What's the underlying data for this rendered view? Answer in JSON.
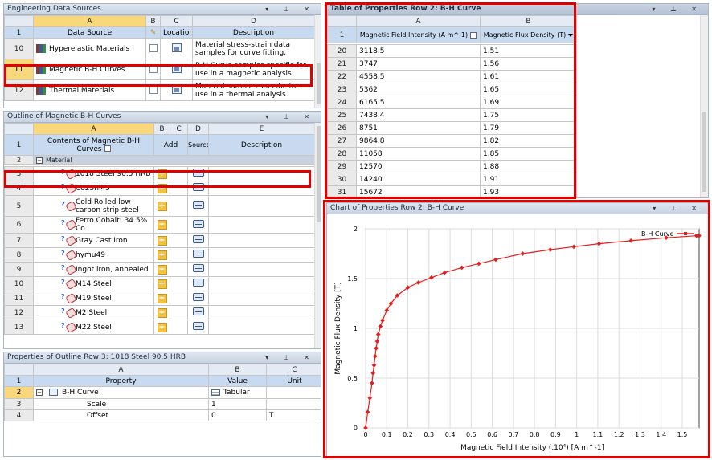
{
  "eds": {
    "title": "Engineering Data Sources",
    "col_letters": [
      "A",
      "B",
      "C",
      "D"
    ],
    "headers": [
      "Data Source",
      "Location",
      "Description"
    ],
    "rows": [
      {
        "n": "10",
        "name": "Hyperelastic Materials",
        "desc": "Material stress-strain data samples for curve fitting."
      },
      {
        "n": "11",
        "name": "Magnetic B-H Curves",
        "desc": "B-H Curve samples specific for use in a magnetic analysis."
      },
      {
        "n": "12",
        "name": "Thermal Materials",
        "desc": "Material samples specific for use in a thermal analysis."
      }
    ]
  },
  "outline": {
    "title": "Outline of Magnetic B-H Curves",
    "col_letters": [
      "A",
      "B",
      "C",
      "D",
      "E"
    ],
    "headers": [
      "Contents of Magnetic B-H Curves",
      "Add",
      "Source",
      "Description"
    ],
    "group": "Material",
    "rows": [
      {
        "n": "3",
        "name": "1018 Steel 90.5 HRB"
      },
      {
        "n": "4",
        "name": "Co25ni45"
      },
      {
        "n": "5",
        "name": "Cold Rolled low carbon strip steel"
      },
      {
        "n": "6",
        "name": "Ferro Cobalt: 34.5% Co"
      },
      {
        "n": "7",
        "name": "Gray Cast Iron"
      },
      {
        "n": "8",
        "name": "hymu49"
      },
      {
        "n": "9",
        "name": "Ingot iron, annealed"
      },
      {
        "n": "10",
        "name": "M14 Steel"
      },
      {
        "n": "11",
        "name": "M19 Steel"
      },
      {
        "n": "12",
        "name": "M2 Steel"
      },
      {
        "n": "13",
        "name": "M22 Steel"
      }
    ]
  },
  "props": {
    "title": "Properties of Outline Row 3: 1018 Steel 90.5 HRB",
    "col_letters": [
      "A",
      "B",
      "C"
    ],
    "headers": [
      "Property",
      "Value",
      "Unit"
    ],
    "rows": [
      {
        "n": "2",
        "prop": "B-H Curve",
        "value": "Tabular",
        "unit": ""
      },
      {
        "n": "3",
        "prop": "Scale",
        "value": "1",
        "unit": ""
      },
      {
        "n": "4",
        "prop": "Offset",
        "value": "0",
        "unit": "T"
      }
    ]
  },
  "table": {
    "title": "Table of Properties Row 2: B-H Curve",
    "col_letters": [
      "A",
      "B"
    ],
    "headers": [
      "Magnetic Field Intensity (A m^-1)",
      "Magnetic Flux Density (T)"
    ],
    "rows": [
      {
        "n": "20",
        "h": "3118.5",
        "b": "1.51"
      },
      {
        "n": "21",
        "h": "3747",
        "b": "1.56"
      },
      {
        "n": "22",
        "h": "4558.5",
        "b": "1.61"
      },
      {
        "n": "23",
        "h": "5362",
        "b": "1.65"
      },
      {
        "n": "24",
        "h": "6165.5",
        "b": "1.69"
      },
      {
        "n": "25",
        "h": "7438.4",
        "b": "1.75"
      },
      {
        "n": "26",
        "h": "8751",
        "b": "1.79"
      },
      {
        "n": "27",
        "h": "9864.8",
        "b": "1.82"
      },
      {
        "n": "28",
        "h": "11058",
        "b": "1.85"
      },
      {
        "n": "29",
        "h": "12570",
        "b": "1.88"
      },
      {
        "n": "30",
        "h": "14240",
        "b": "1.91"
      },
      {
        "n": "31",
        "h": "15672",
        "b": "1.93"
      }
    ]
  },
  "chart_panel": {
    "title": "Chart of Properties Row 2: B-H Curve"
  },
  "chart_data": {
    "type": "line",
    "xlabel": "Magnetic Field Intensity  (.10⁴)  [A m^-1]",
    "ylabel": "Magnetic Flux Density  [T]",
    "xlim": [
      0,
      1.58
    ],
    "ylim": [
      0,
      2
    ],
    "x_ticks": [
      "0",
      "0.1",
      "0.2",
      "0.3",
      "0.4",
      "0.5",
      "0.6",
      "0.7",
      "0.8",
      "0.9",
      "1",
      "1.1",
      "1.2",
      "1.3",
      "1.4",
      "1.5"
    ],
    "y_ticks": [
      "0",
      "0.5",
      "1",
      "1.5",
      "2"
    ],
    "grid": true,
    "legend": "top-right",
    "series": [
      {
        "name": "B-H Curve",
        "color": "#e02020",
        "x": [
          0,
          0.01,
          0.02,
          0.03,
          0.035,
          0.04,
          0.045,
          0.05,
          0.055,
          0.06,
          0.07,
          0.08,
          0.1,
          0.12,
          0.15,
          0.2,
          0.25,
          0.31187,
          0.3747,
          0.45585,
          0.5362,
          0.61655,
          0.74384,
          0.8751,
          0.98648,
          1.1058,
          1.257,
          1.424,
          1.5672,
          1.58
        ],
        "y": [
          0,
          0.16,
          0.3,
          0.45,
          0.55,
          0.63,
          0.72,
          0.8,
          0.87,
          0.94,
          1.02,
          1.08,
          1.18,
          1.25,
          1.33,
          1.41,
          1.46,
          1.51,
          1.56,
          1.61,
          1.65,
          1.69,
          1.75,
          1.79,
          1.82,
          1.85,
          1.88,
          1.91,
          1.93,
          1.93
        ]
      }
    ]
  }
}
